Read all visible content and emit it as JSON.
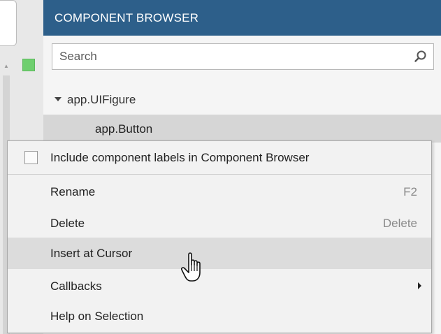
{
  "panel": {
    "title": "COMPONENT BROWSER",
    "search_placeholder": "Search"
  },
  "tree": {
    "root_label": "app.UIFigure",
    "child_label": "app.Button"
  },
  "context_menu": {
    "checkbox_label": "Include component labels in Component Browser",
    "checkbox_checked": false,
    "items": [
      {
        "label": "Rename",
        "shortcut": "F2"
      },
      {
        "label": "Delete",
        "shortcut": "Delete"
      },
      {
        "label": "Insert at Cursor",
        "shortcut": ""
      },
      {
        "label": "Callbacks",
        "shortcut": ""
      },
      {
        "label": "Help on Selection",
        "shortcut": ""
      }
    ]
  },
  "colors": {
    "header_bg": "#2d5f8a",
    "selected_row": "#d6d6d6",
    "menu_highlight": "#dcdcdc",
    "status_green": "#6fcf6f"
  },
  "icons": [
    "search-icon",
    "caret-down-icon",
    "submenu-arrow-icon",
    "hand-pointer-icon"
  ]
}
